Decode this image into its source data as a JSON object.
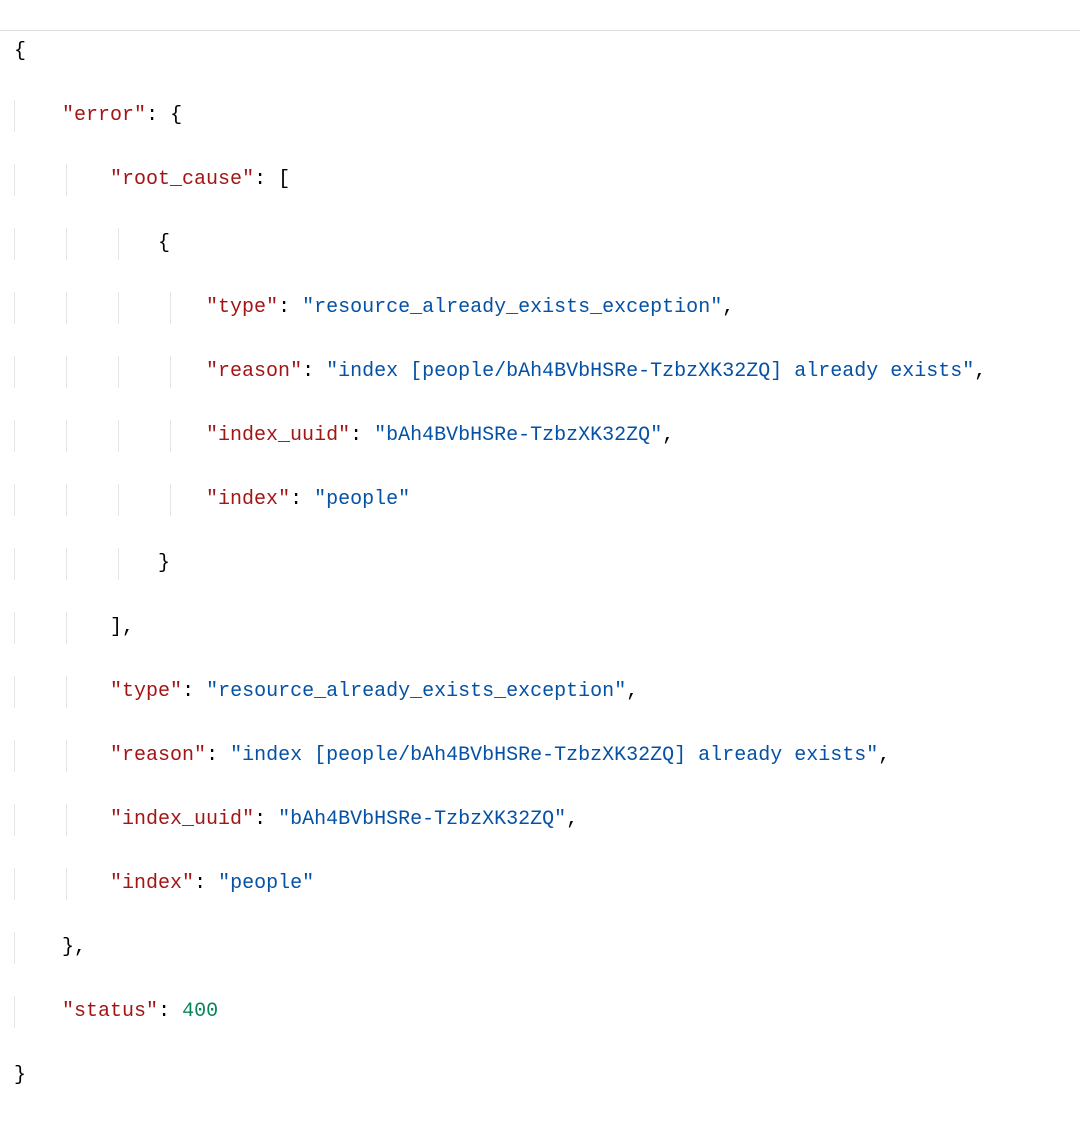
{
  "json": {
    "error": {
      "root_cause": [
        {
          "type": "resource_already_exists_exception",
          "reason": "index [people/bAh4BVbHSRe-TzbzXK32ZQ] already exists",
          "index_uuid": "bAh4BVbHSRe-TzbzXK32ZQ",
          "index": "people"
        }
      ],
      "type": "resource_already_exists_exception",
      "reason": "index [people/bAh4BVbHSRe-TzbzXK32ZQ] already exists",
      "index_uuid": "bAh4BVbHSRe-TzbzXK32ZQ",
      "index": "people"
    },
    "status": 400
  },
  "keys": {
    "error": "error",
    "root_cause": "root_cause",
    "type": "type",
    "reason": "reason",
    "index_uuid": "index_uuid",
    "index": "index",
    "status": "status"
  }
}
